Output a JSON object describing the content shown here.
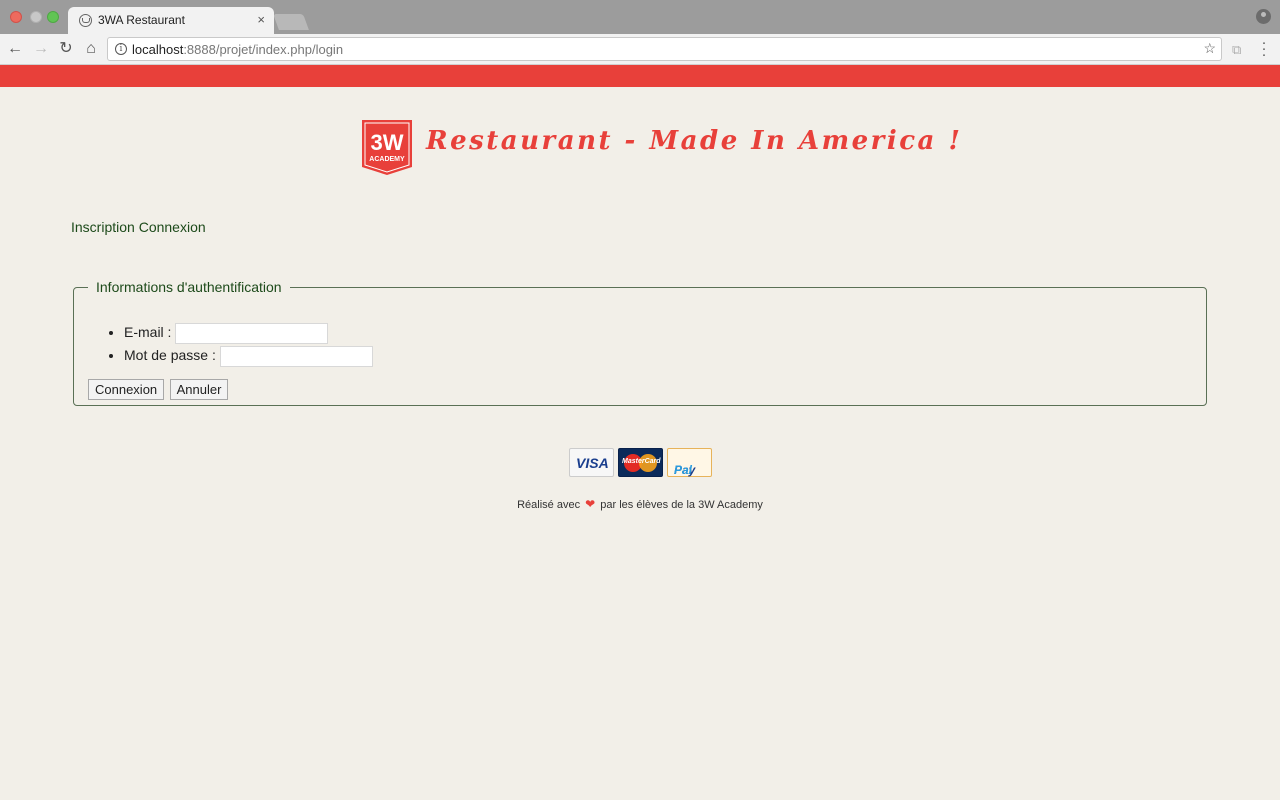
{
  "browser": {
    "tab_title": "3WA Restaurant",
    "tab_close": "×",
    "url_host": "localhost",
    "url_rest": ":8888/projet/index.php/login"
  },
  "header": {
    "logo_text_top": "3W",
    "logo_text_bottom": "ACADEMY",
    "title": "Restaurant - Made In America !"
  },
  "nav": {
    "register": "Inscription",
    "login": "Connexion"
  },
  "login_form": {
    "legend": "Informations d'authentification",
    "email_label": "E-mail :",
    "email_value": "",
    "password_label": "Mot de passe :",
    "password_value": "",
    "submit_label": "Connexion",
    "cancel_label": "Annuler"
  },
  "payments": {
    "visa": "VISA",
    "mastercard": "MasterCard",
    "paypal_1": "Pay",
    "paypal_2": "Pal"
  },
  "footer": {
    "text_before": "Réalisé avec",
    "heart": "❤",
    "text_after": "par les élèves de la 3W Academy"
  },
  "colors": {
    "brand_red": "#e8403a",
    "text_green": "#1d4a1a",
    "page_bg": "#f2efe8"
  }
}
